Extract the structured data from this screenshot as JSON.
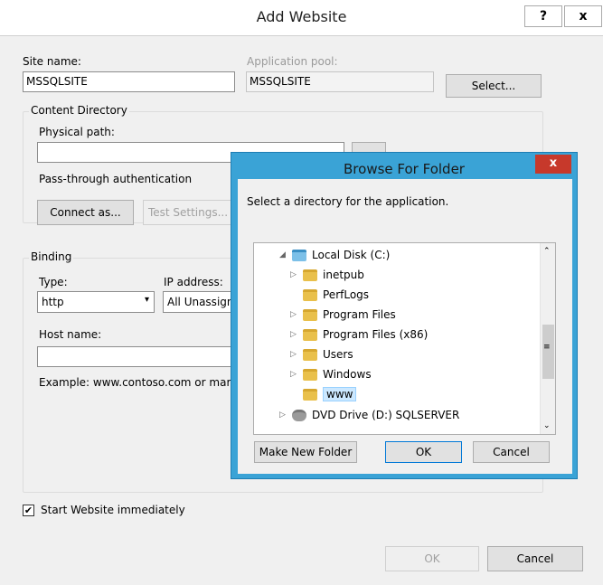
{
  "window": {
    "title": "Add Website",
    "help_label": "?",
    "close_label": "x"
  },
  "site": {
    "site_name_label": "Site name:",
    "site_name_value": "MSSQLSITE",
    "app_pool_label": "Application pool:",
    "app_pool_value": "MSSQLSITE",
    "select_label": "Select..."
  },
  "content": {
    "group_label": "Content Directory",
    "physical_path_label": "Physical path:",
    "physical_path_value": "",
    "pass_through_label": "Pass-through authentication",
    "connect_as_label": "Connect as...",
    "test_settings_label": "Test Settings..."
  },
  "binding": {
    "group_label": "Binding",
    "type_label": "Type:",
    "type_value": "http",
    "ip_label": "IP address:",
    "ip_value": "All Unassign",
    "host_label": "Host name:",
    "host_value": "",
    "example_label": "Example: www.contoso.com or mar"
  },
  "start_immediately_label": "Start Website immediately",
  "start_immediately_checked": true,
  "footer": {
    "ok_label": "OK",
    "cancel_label": "Cancel"
  },
  "browse": {
    "title": "Browse For Folder",
    "close_label": "x",
    "instruction": "Select a directory for the application.",
    "tree": [
      {
        "label": "Local Disk (C:)",
        "icon": "drive-icon",
        "expanded": true
      },
      {
        "label": "inetpub",
        "icon": "folder-icon"
      },
      {
        "label": "PerfLogs",
        "icon": "folder-icon"
      },
      {
        "label": "Program Files",
        "icon": "folder-icon"
      },
      {
        "label": "Program Files (x86)",
        "icon": "folder-icon"
      },
      {
        "label": "Users",
        "icon": "folder-icon"
      },
      {
        "label": "Windows",
        "icon": "folder-icon"
      },
      {
        "label": "www",
        "icon": "folder-icon",
        "selected": true
      },
      {
        "label": "DVD Drive (D:) SQLSERVER",
        "icon": "dvd-icon"
      }
    ],
    "make_new_folder_label": "Make New Folder",
    "ok_label": "OK",
    "cancel_label": "Cancel"
  }
}
